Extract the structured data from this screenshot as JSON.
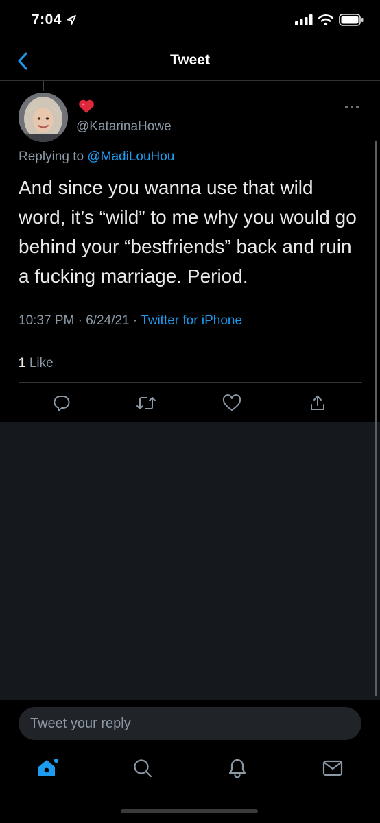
{
  "status_bar": {
    "time": "7:04"
  },
  "nav": {
    "title": "Tweet"
  },
  "tweet": {
    "emoji": "❤️",
    "handle": "@KatarinaHowe",
    "replying_prefix": "Replying to",
    "replying_to": "@MadiLouHou",
    "text": "And since you wanna use that wild word, it’s “wild” to me why you would go behind your “bestfriends” back and ruin a fucking marriage. Period.",
    "time": "10:37 PM",
    "date": "6/24/21",
    "source": "Twitter for iPhone",
    "like_count": "1",
    "like_label": "Like"
  },
  "composer": {
    "placeholder": "Tweet your reply"
  },
  "colors": {
    "accent": "#1d9bf0",
    "background": "#000000",
    "muted": "#8b98a5",
    "empty_area": "#15181c"
  },
  "icons": [
    "back-chevron-icon",
    "reply-icon",
    "retweet-icon",
    "like-icon",
    "share-icon",
    "home-icon",
    "search-icon",
    "notifications-icon",
    "messages-icon"
  ]
}
